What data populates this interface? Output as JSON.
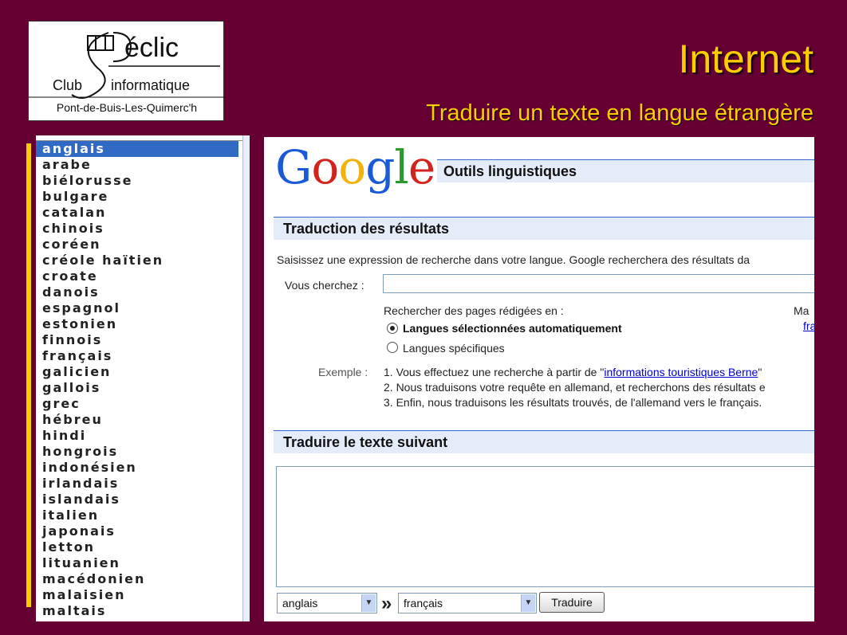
{
  "logo": {
    "brand": "éclic",
    "club": "Club",
    "informatique": "informatique",
    "place": "Pont-de-Buis-Les-Quimerc'h"
  },
  "slide": {
    "title": "Internet",
    "subtitle": "Traduire un texte en langue étrangère"
  },
  "languages": {
    "selected": "anglais",
    "items": [
      "anglais",
      "arabe",
      "biélorusse",
      "bulgare",
      "catalan",
      "chinois",
      "coréen",
      "créole haïtien",
      "croate",
      "danois",
      "espagnol",
      "estonien",
      "finnois",
      "français",
      "galicien",
      "gallois",
      "grec",
      "hébreu",
      "hindi",
      "hongrois",
      "indonésien",
      "irlandais",
      "islandais",
      "italien",
      "japonais",
      "letton",
      "lituanien",
      "macédonien",
      "malaisien",
      "maltais"
    ]
  },
  "google": {
    "logo_letters": [
      "G",
      "o",
      "o",
      "g",
      "l",
      "e"
    ],
    "logo_colors": [
      "#1a5ad6",
      "#d2231c",
      "#f1b40f",
      "#1a5ad6",
      "#2a9a2a",
      "#d2231c"
    ],
    "tools_title": "Outils linguistiques",
    "results_section": "Traduction des résultats",
    "intro": "Saisissez une expression de recherche dans votre langue. Google recherchera des résultats da",
    "search_label": "Vous cherchez :",
    "search_value": "",
    "search_pages_label": "Rechercher des pages rédigées en :",
    "ma_label": "Ma",
    "fr_link": "fra",
    "radio_auto": "Langues sélectionnées automatiquement",
    "radio_specific": "Langues spécifiques",
    "example_label": "Exemple :",
    "example_1_prefix": "1. Vous effectuez une recherche à partir de \"",
    "example_1_link": "informations touristiques Berne",
    "example_1_suffix": "\"",
    "example_2": "2. Nous traduisons votre requête en allemand, et recherchons des résultats e",
    "example_3": "3. Enfin, nous traduisons les résultats trouvés, de l'allemand vers le français.",
    "translate_section": "Traduire le texte suivant",
    "source_lang": "anglais",
    "target_lang": "français",
    "arrow": "»",
    "translate_button": "Traduire"
  }
}
